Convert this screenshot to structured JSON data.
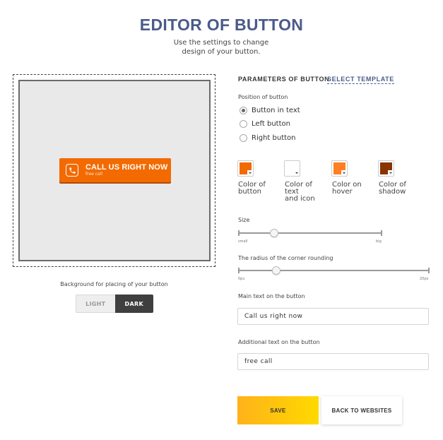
{
  "header": {
    "title": "EDITOR OF BUTTON",
    "subtitle_line1": "Use the settings to change",
    "subtitle_line2": "design of your button."
  },
  "preview": {
    "button_main_text": "CALL US RIGHT NOW",
    "button_sub_text": "free call",
    "button_color": "#f26a00",
    "icon": "phone-icon",
    "background_label": "Background for placing of your button",
    "bg_options": {
      "light": "LIGHT",
      "dark": "DARK"
    },
    "bg_selected": "DARK"
  },
  "params": {
    "heading": "PARAMETERS OF BUTTON",
    "template_link": "SELECT TEMPLATE",
    "position_label": "Position of button",
    "positions": [
      "Button in text",
      "Left button",
      "Right button"
    ],
    "position_selected": "Button in text",
    "colors": [
      {
        "lines": [
          "Color of",
          "button"
        ],
        "hex": "#f26a00"
      },
      {
        "lines": [
          "Color of",
          "text",
          "and icon"
        ],
        "hex": "#ffffff"
      },
      {
        "lines": [
          "Color on",
          "hover"
        ],
        "hex": "#ff7f22"
      },
      {
        "lines": [
          "Color of",
          "shadow"
        ],
        "hex": "#8a3400"
      }
    ],
    "size_label": "Size",
    "size_min": "small",
    "size_max": "big",
    "size_value": 0.25,
    "radius_label": "The radius of the corner rounding",
    "radius_min": "0px",
    "radius_max": "20px",
    "radius_value": 0.2,
    "main_text_label": "Main text on the button",
    "main_text_value": "Call us right now",
    "additional_text_label": "Additional text on the button",
    "additional_text_value": "free call"
  },
  "actions": {
    "save": "SAVE",
    "back": "BACK TO WEBSITES"
  }
}
